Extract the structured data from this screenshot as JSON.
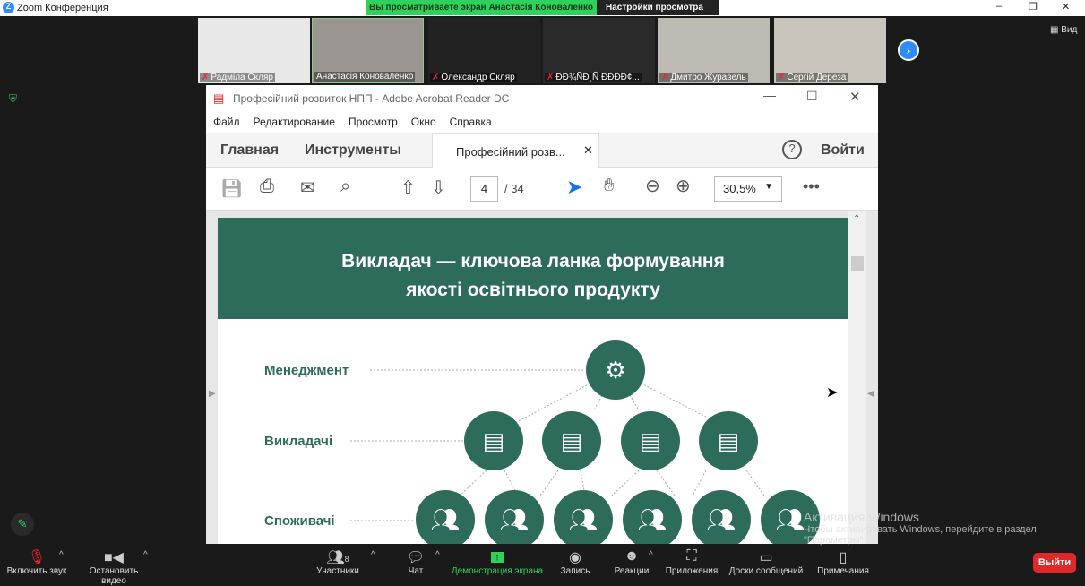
{
  "window": {
    "title": "Zoom Конференция",
    "banner": "Вы просматриваете экран Анастасія Коноваленко",
    "view_settings": "Настройки просмотра",
    "view_button": "Вид"
  },
  "participants": [
    {
      "name": "Радміла Скляр",
      "muted": true
    },
    {
      "name": "Анастасія Коноваленко",
      "muted": false
    },
    {
      "name": "Олександр Скляр",
      "muted": true
    },
    {
      "name": "ÐÐ¾ÑÐ¸Ñ ÐÐÐÐ¢...",
      "muted": true
    },
    {
      "name": "Дмитро Журавель",
      "muted": true
    },
    {
      "name": "Сергій Дереза",
      "muted": true
    }
  ],
  "acrobat": {
    "title": "Професійний розвиток НПП - Adobe Acrobat Reader DC",
    "menu": [
      "Файл",
      "Редактирование",
      "Просмотр",
      "Окно",
      "Справка"
    ],
    "tabs": {
      "home": "Главная",
      "tools": "Инструменты",
      "doc": "Професійний розв..."
    },
    "login": "Войти",
    "page": "4",
    "pages": "/ 34",
    "zoom": "30,5%"
  },
  "slide": {
    "title1": "Викладач — ключова ланка формування",
    "title2": "якості освітнього продукту",
    "labels": [
      "Менеджмент",
      "Викладачі",
      "Споживачі"
    ],
    "color": "#2d6b5b"
  },
  "watermark": {
    "line1": "Активация Windows",
    "line2": "Чтобы активировать Windows, перейдите в раздел",
    "line3": "\"Параметры\"."
  },
  "toolbar": {
    "audio": "Включить звук",
    "video": "Остановить видео",
    "participants": "Участники",
    "participants_count": "8",
    "chat": "Чат",
    "share": "Демонстрация экрана",
    "record": "Запись",
    "reactions": "Реакции",
    "apps": "Приложения",
    "whiteboards": "Доски сообщений",
    "notes": "Примечания",
    "leave": "Выйти"
  }
}
